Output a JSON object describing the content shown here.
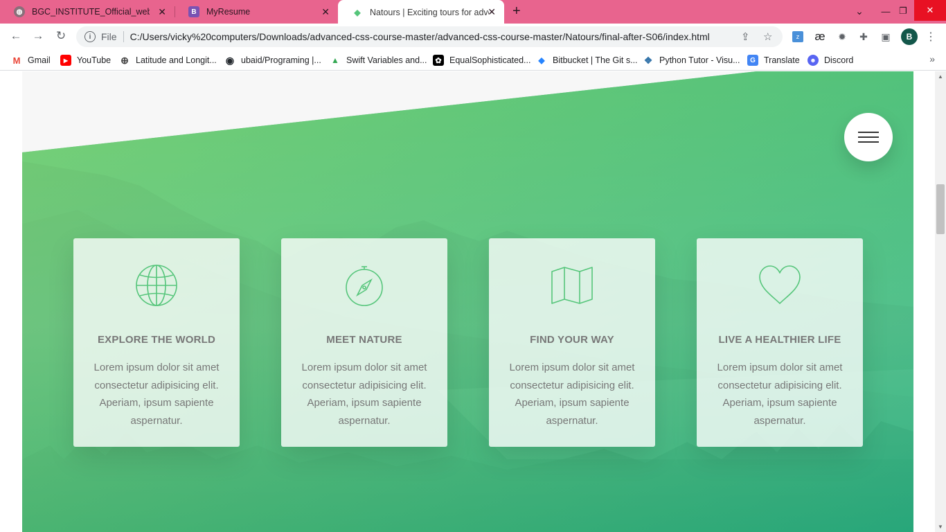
{
  "browser": {
    "tabs": [
      {
        "title": "BGC_INSTITUTE_Official_website",
        "icon": "globe-favicon"
      },
      {
        "title": "MyResume",
        "icon": "bootstrap-favicon",
        "icon_text": "B"
      },
      {
        "title": "Natours | Exciting tours for adventurous people",
        "icon": "natours-favicon",
        "icon_text": "◆",
        "active": true
      }
    ],
    "new_tab": "+",
    "window_controls": {
      "minimize": "—",
      "restore": "❐",
      "close": "✕"
    },
    "address_scheme": "File",
    "address_url": "C:/Users/vicky%20computers/Downloads/advanced-css-course-master/advanced-css-course-master/Natours/final-after-S06/index.html",
    "profile_initial": "B",
    "extensions": [
      "translate-extension",
      "ae-extension",
      "bug-extension",
      "puzzle-extensions",
      "sidebar-toggle"
    ],
    "ext_text": {
      "ae": "æ"
    },
    "bookmarks": [
      {
        "label": "Gmail",
        "icon": "gmail-icon",
        "color": "#ea4335",
        "icon_text": "M"
      },
      {
        "label": "YouTube",
        "icon": "youtube-icon",
        "color": "#ff0000",
        "icon_text": "▶"
      },
      {
        "label": "Latitude and Longit...",
        "icon": "compass-site-icon",
        "color": "#444444",
        "icon_text": "⊕"
      },
      {
        "label": "ubaid/Programing |...",
        "icon": "github-icon",
        "color": "#24292e",
        "icon_text": "◉"
      },
      {
        "label": "Swift Variables and...",
        "icon": "triangle-logo-icon",
        "color": "#34a853",
        "icon_text": "▲"
      },
      {
        "label": "EqualSophisticated...",
        "icon": "openai-icon",
        "color": "#000000",
        "icon_text": "✿"
      },
      {
        "label": "Bitbucket | The Git s...",
        "icon": "bitbucket-icon",
        "color": "#2684ff",
        "icon_text": "◆"
      },
      {
        "label": "Python Tutor - Visu...",
        "icon": "python-icon",
        "color": "#3776ab",
        "icon_text": "❖"
      },
      {
        "label": "Translate",
        "icon": "google-translate-icon",
        "color": "#4285f4",
        "icon_text": "G"
      },
      {
        "label": "Discord",
        "icon": "discord-icon",
        "color": "#5865f2",
        "icon_text": "☻"
      }
    ],
    "more_bookmarks": "»"
  },
  "page": {
    "colors": {
      "green_light": "#7ed56f",
      "green_dark": "#28b485",
      "text_grey": "#777777",
      "background": "#f7f7f7"
    },
    "features": [
      {
        "icon": "globe-icon",
        "title": "EXPLORE THE WORLD",
        "text": "Lorem ipsum dolor sit amet consectetur adipisicing elit. Aperiam, ipsum sapiente aspernatur."
      },
      {
        "icon": "compass-icon",
        "title": "MEET NATURE",
        "text": "Lorem ipsum dolor sit amet consectetur adipisicing elit. Aperiam, ipsum sapiente aspernatur."
      },
      {
        "icon": "map-icon",
        "title": "FIND YOUR WAY",
        "text": "Lorem ipsum dolor sit amet consectetur adipisicing elit. Aperiam, ipsum sapiente aspernatur."
      },
      {
        "icon": "heart-icon",
        "title": "LIVE A HEALTHIER LIFE",
        "text": "Lorem ipsum dolor sit amet consectetur adipisicing elit. Aperiam, ipsum sapiente aspernatur."
      }
    ]
  }
}
